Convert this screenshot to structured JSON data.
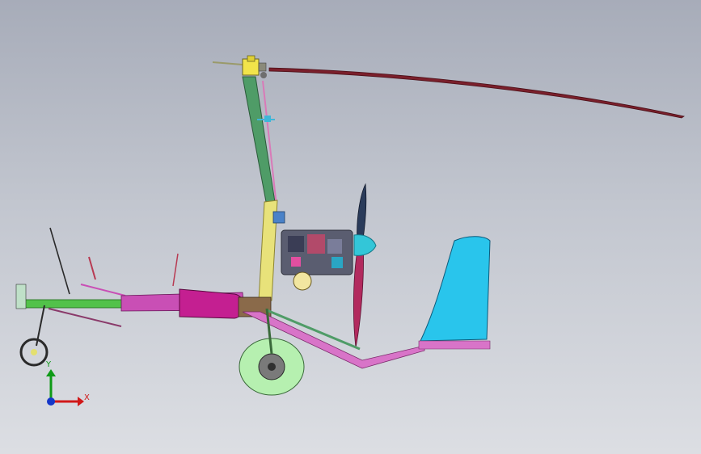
{
  "viewport": {
    "background_top": "#a7acb9",
    "background_bottom": "#dcdee3"
  },
  "model": {
    "part_colors": {
      "rotor_blade": "#7a1f2b",
      "mast": "#4f9c67",
      "mast_brace": "#d97ab8",
      "keel_beam": "#c94fb5",
      "fuel_tank": "#c41f91",
      "seat_support": "#e8e27a",
      "engine": "#5a5d70",
      "propeller": "#b22a5e",
      "spinner": "#33c6d8",
      "tail_fin": "#29c5ec",
      "tail_boom": "#d874c8",
      "main_wheel": "#b6f0b0",
      "nose_frame": "#52c24a",
      "nose_wheel": "#2a2a2a"
    }
  },
  "triad": {
    "x_label": "X",
    "y_label": "Y",
    "x_color": "#d01818",
    "y_color": "#0f9a17",
    "z_color": "#1537c9"
  }
}
